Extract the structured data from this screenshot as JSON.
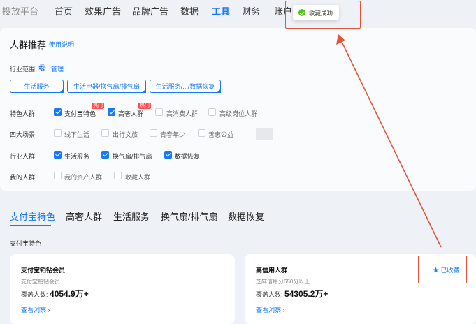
{
  "nav": {
    "brand": "投放平台",
    "items": [
      "首页",
      "效果广告",
      "品牌广告",
      "数据",
      "工具",
      "财务",
      "账户"
    ],
    "active_index": 4
  },
  "panel": {
    "title": "人群推荐",
    "help_link": "使用说明",
    "scope_label": "行业范围",
    "manage_link": "管理",
    "scope_tags": [
      "生活服务",
      "生活电器/换气扇/排气扇",
      "生活服务/.../数据恢复"
    ],
    "rows": [
      {
        "label": "特色人群",
        "options": [
          {
            "text": "支付宝特色",
            "checked": true,
            "hot": "热门"
          },
          {
            "text": "高奢人群",
            "checked": true,
            "hot": "热门"
          },
          {
            "text": "高消费人群",
            "checked": false
          },
          {
            "text": "高级岗位人群",
            "checked": false
          }
        ]
      },
      {
        "label": "四大场景",
        "options": [
          {
            "text": "线下生活",
            "checked": false
          },
          {
            "text": "出行文旅",
            "checked": false
          },
          {
            "text": "青春年少",
            "checked": false
          },
          {
            "text": "善惠公益",
            "checked": false
          }
        ]
      },
      {
        "label": "行业人群",
        "options": [
          {
            "text": "生活服务",
            "checked": true
          },
          {
            "text": "换气扇/排气扇",
            "checked": true
          },
          {
            "text": "数据恢复",
            "checked": true
          }
        ]
      },
      {
        "label": "我的人群",
        "options": [
          {
            "text": "我的资产人群",
            "checked": false
          },
          {
            "text": "收藏人群",
            "checked": false
          }
        ]
      }
    ]
  },
  "tabs": {
    "items": [
      "支付宝特色",
      "高奢人群",
      "生活服务",
      "换气扇/排气扇",
      "数据恢复"
    ],
    "active_index": 0
  },
  "section_title": "支付宝特色",
  "cards": [
    {
      "title": "支付宝铂钻会员",
      "subtitle": "支付宝铂钻会员",
      "coverage_label": "覆盖人数:",
      "coverage_value": "4054.9万+",
      "link": "查看洞察"
    },
    {
      "title": "高信用人群",
      "subtitle": "芝麻信用分650分以上",
      "coverage_label": "覆盖人数:",
      "coverage_value": "54305.2万+",
      "link": "查看洞察",
      "favorite_label": "已收藏"
    }
  ],
  "toast": {
    "text": "收藏成功"
  },
  "colors": {
    "accent": "#1677ff",
    "annotation_red": "#e5533a",
    "success": "#52c41a",
    "hot": "#ff4d4f"
  }
}
